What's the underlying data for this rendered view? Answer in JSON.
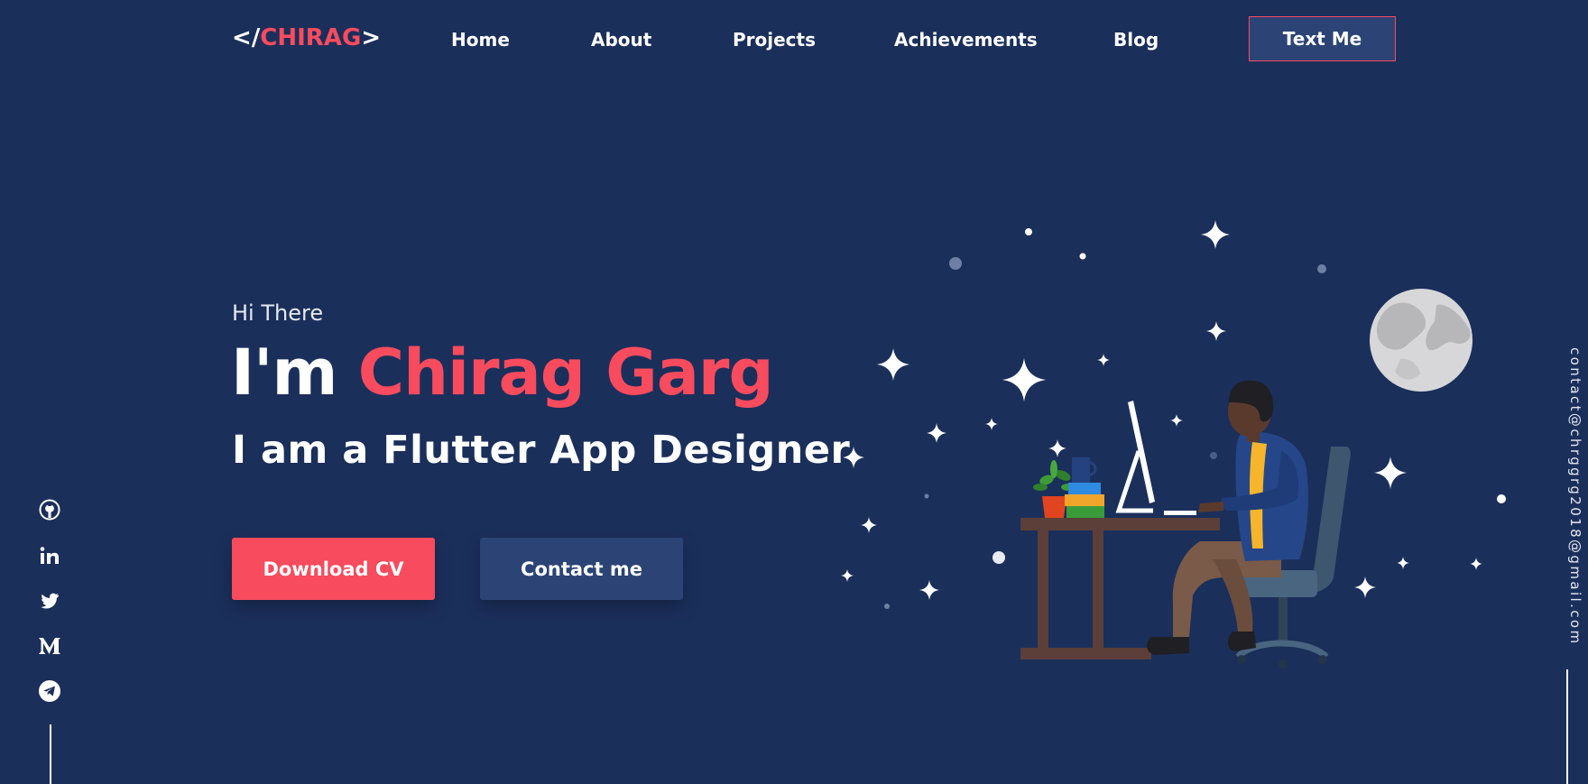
{
  "nav": {
    "logo_open": "</",
    "logo_name": "CHIRAG",
    "logo_close": ">",
    "links": [
      "Home",
      "About",
      "Projects",
      "Achievements",
      "Blog"
    ],
    "cta": "Text Me"
  },
  "hero": {
    "greeting": "Hi There",
    "im": "I'm ",
    "name": "Chirag Garg",
    "role": "I am a  Flutter App Designer",
    "download_cv": "Download CV",
    "contact_me": "Contact me"
  },
  "social": [
    "github-icon",
    "linkedin-icon",
    "twitter-icon",
    "medium-icon",
    "telegram-icon"
  ],
  "email": "contact@chrggrg2018@gmail.com",
  "colors": {
    "background": "#1b2f5b",
    "accent": "#f84b5e",
    "button_secondary": "#2b4475"
  }
}
